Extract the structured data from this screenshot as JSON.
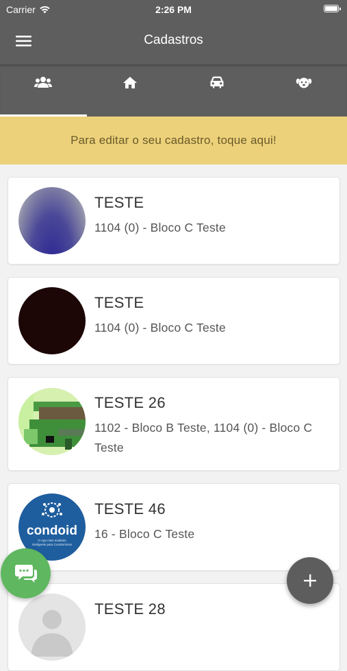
{
  "status_bar": {
    "carrier": "Carrier",
    "time": "2:26 PM"
  },
  "app_bar": {
    "title": "Cadastros",
    "menu_icon": "hamburger-menu-icon"
  },
  "tabs": [
    {
      "icon": "people-icon",
      "selected": true
    },
    {
      "icon": "home-icon",
      "selected": false
    },
    {
      "icon": "car-icon",
      "selected": false
    },
    {
      "icon": "pet-icon",
      "selected": false
    }
  ],
  "notice": {
    "text": "Para editar o seu cadastro, toque aqui!"
  },
  "residents": [
    {
      "name": "TESTE",
      "unit": "1104 (0) - Bloco C Teste"
    },
    {
      "name": "TESTE",
      "unit": "1104 (0) - Bloco C Teste"
    },
    {
      "name": "TESTE 26",
      "unit": "1102 - Bloco B Teste, 1104 (0) - Bloco C Teste"
    },
    {
      "name": "TESTE 46",
      "unit": "16 - Bloco C Teste"
    },
    {
      "name": "TESTE 28",
      "unit": ""
    }
  ],
  "logo": {
    "text": "condoid",
    "tagline": "O App mais avaliado inteligente para Condomínios"
  },
  "colors": {
    "app_bar": "#5e5e5e",
    "notice_background": "#ecd17a",
    "fab": "#5d5d5d",
    "chat_button": "#5fb760"
  },
  "fab_icon": "plus-icon",
  "chat_icon": "chat-bubbles-icon"
}
